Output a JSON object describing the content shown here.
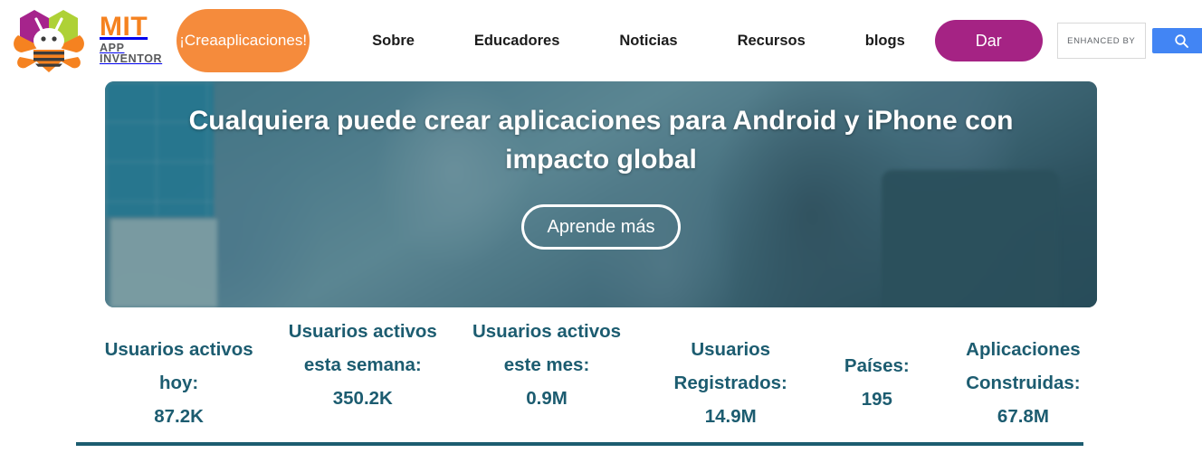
{
  "header": {
    "logo": {
      "brand": "MIT",
      "subtitle": "APP INVENTOR",
      "icon": "app-inventor-bee-logo"
    },
    "create_button": {
      "line1": "¡Crea",
      "line2": "aplicaciones!"
    },
    "nav": [
      {
        "label": "Sobre"
      },
      {
        "label": "Educadores"
      },
      {
        "label": "Noticias"
      },
      {
        "label": "Recursos"
      },
      {
        "label": "blogs"
      }
    ],
    "donate_button": "Dar",
    "search": {
      "branding_label": "ENHANCED BY",
      "placeholder": "ENHANCED BY",
      "value": "",
      "button_icon": "search-icon"
    }
  },
  "hero": {
    "title": "Cualquiera puede crear aplicaciones para Android y iPhone con impacto global",
    "button": "Aprende más"
  },
  "stats": [
    {
      "label": "Usuarios activos hoy:",
      "value": "87.2K"
    },
    {
      "label": "Usuarios activos esta semana:",
      "value": "350.2K"
    },
    {
      "label": "Usuarios activos este mes:",
      "value": "0.9M"
    },
    {
      "label": "Usuarios Registrados:",
      "value": "14.9M"
    },
    {
      "label": "Países:",
      "value": "195"
    },
    {
      "label": "Aplicaciones Construidas:",
      "value": "67.8M"
    }
  ],
  "colors": {
    "orange": "#f58220",
    "magenta": "#a52384",
    "teal": "#1c5c70",
    "google_blue": "#4285f4",
    "hero_overlay": "#1d5c6e"
  }
}
